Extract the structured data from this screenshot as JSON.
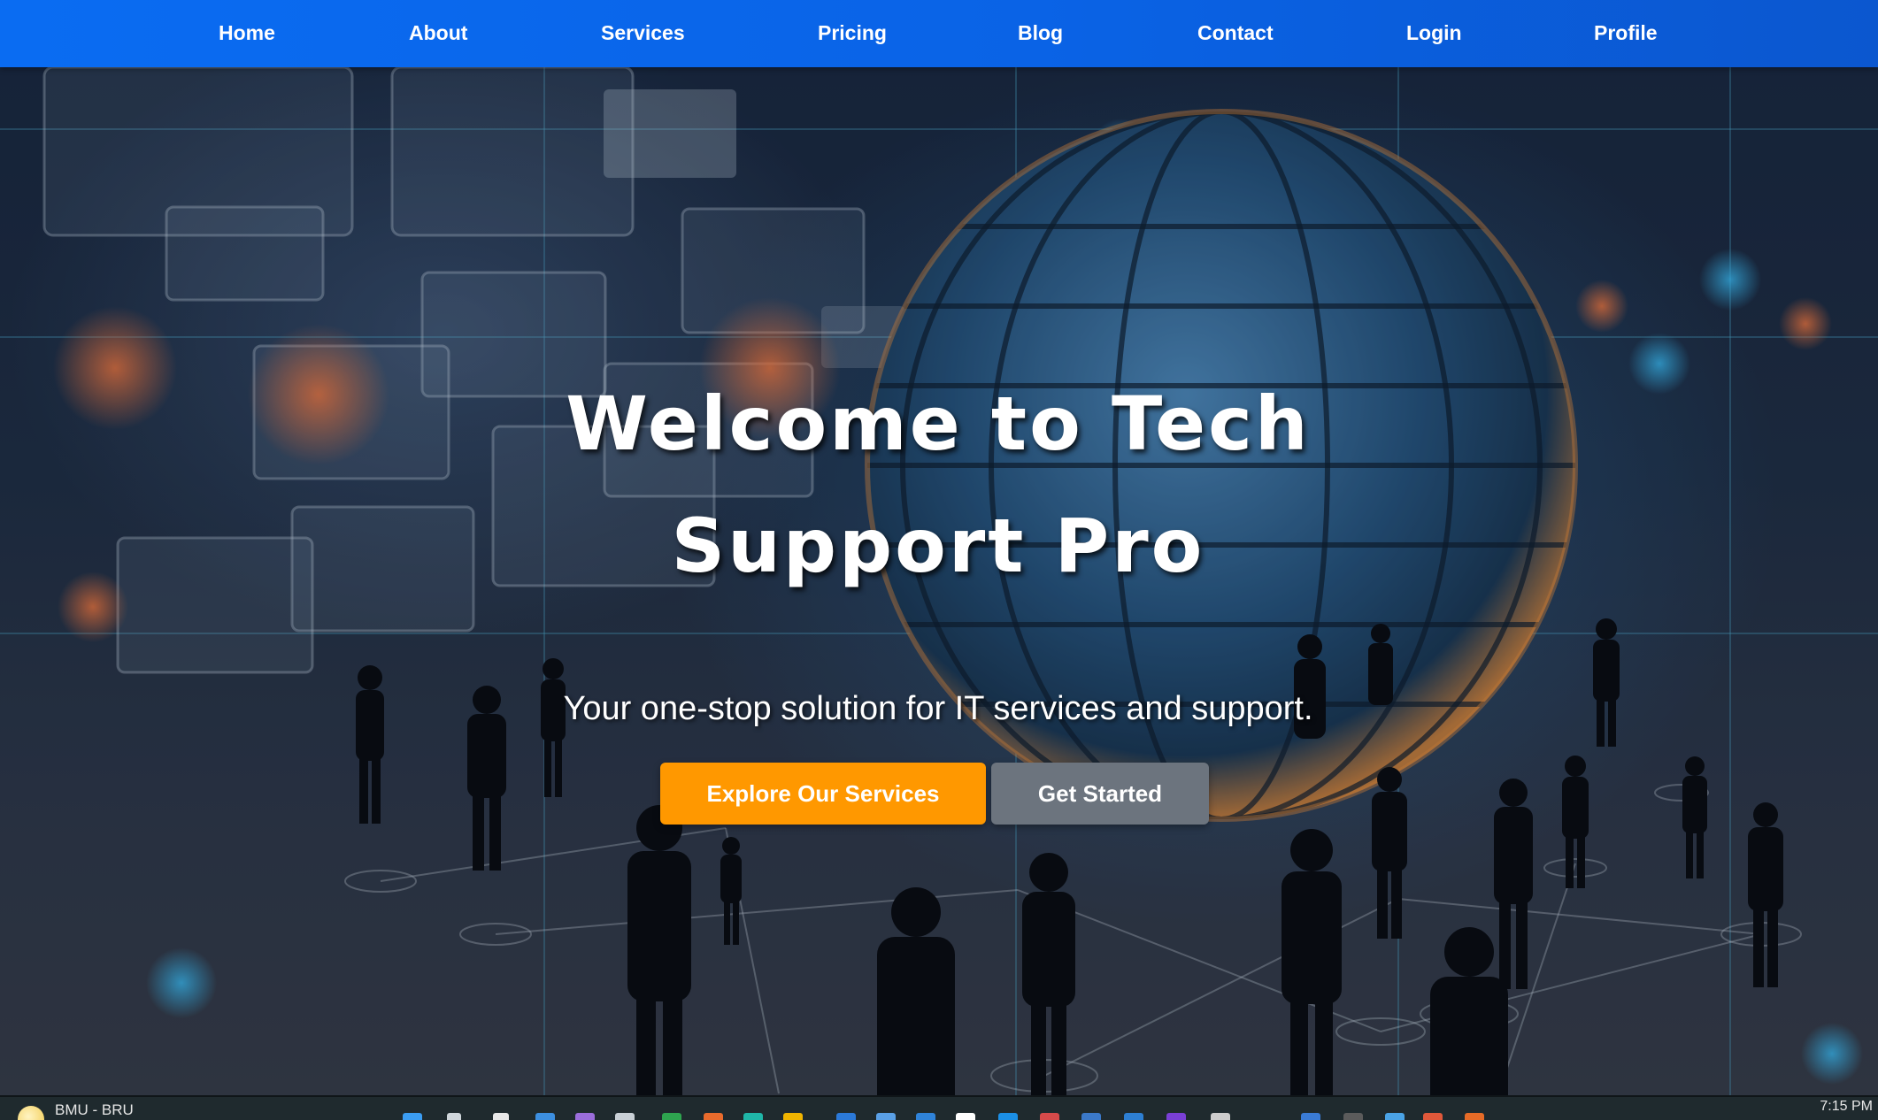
{
  "nav": {
    "items": [
      {
        "label": "Home"
      },
      {
        "label": "About"
      },
      {
        "label": "Services"
      },
      {
        "label": "Pricing"
      },
      {
        "label": "Blog"
      },
      {
        "label": "Contact"
      },
      {
        "label": "Login"
      },
      {
        "label": "Profile"
      }
    ]
  },
  "hero": {
    "title_line1": "Welcome to Tech",
    "title_line2": "Support Pro",
    "subtitle": "Your one-stop solution for IT services and support.",
    "primary_button": "Explore Our Services",
    "secondary_button": "Get Started",
    "background_icon": "globe-network-people-image"
  },
  "taskbar": {
    "weather_text": "BMU - BRU",
    "clock": "7:15 PM"
  },
  "colors": {
    "nav_bg": "#0a63e6",
    "primary_button": "#ff9800",
    "secondary_button": "#6c747e",
    "taskbar_bg": "#1f2a2e"
  }
}
